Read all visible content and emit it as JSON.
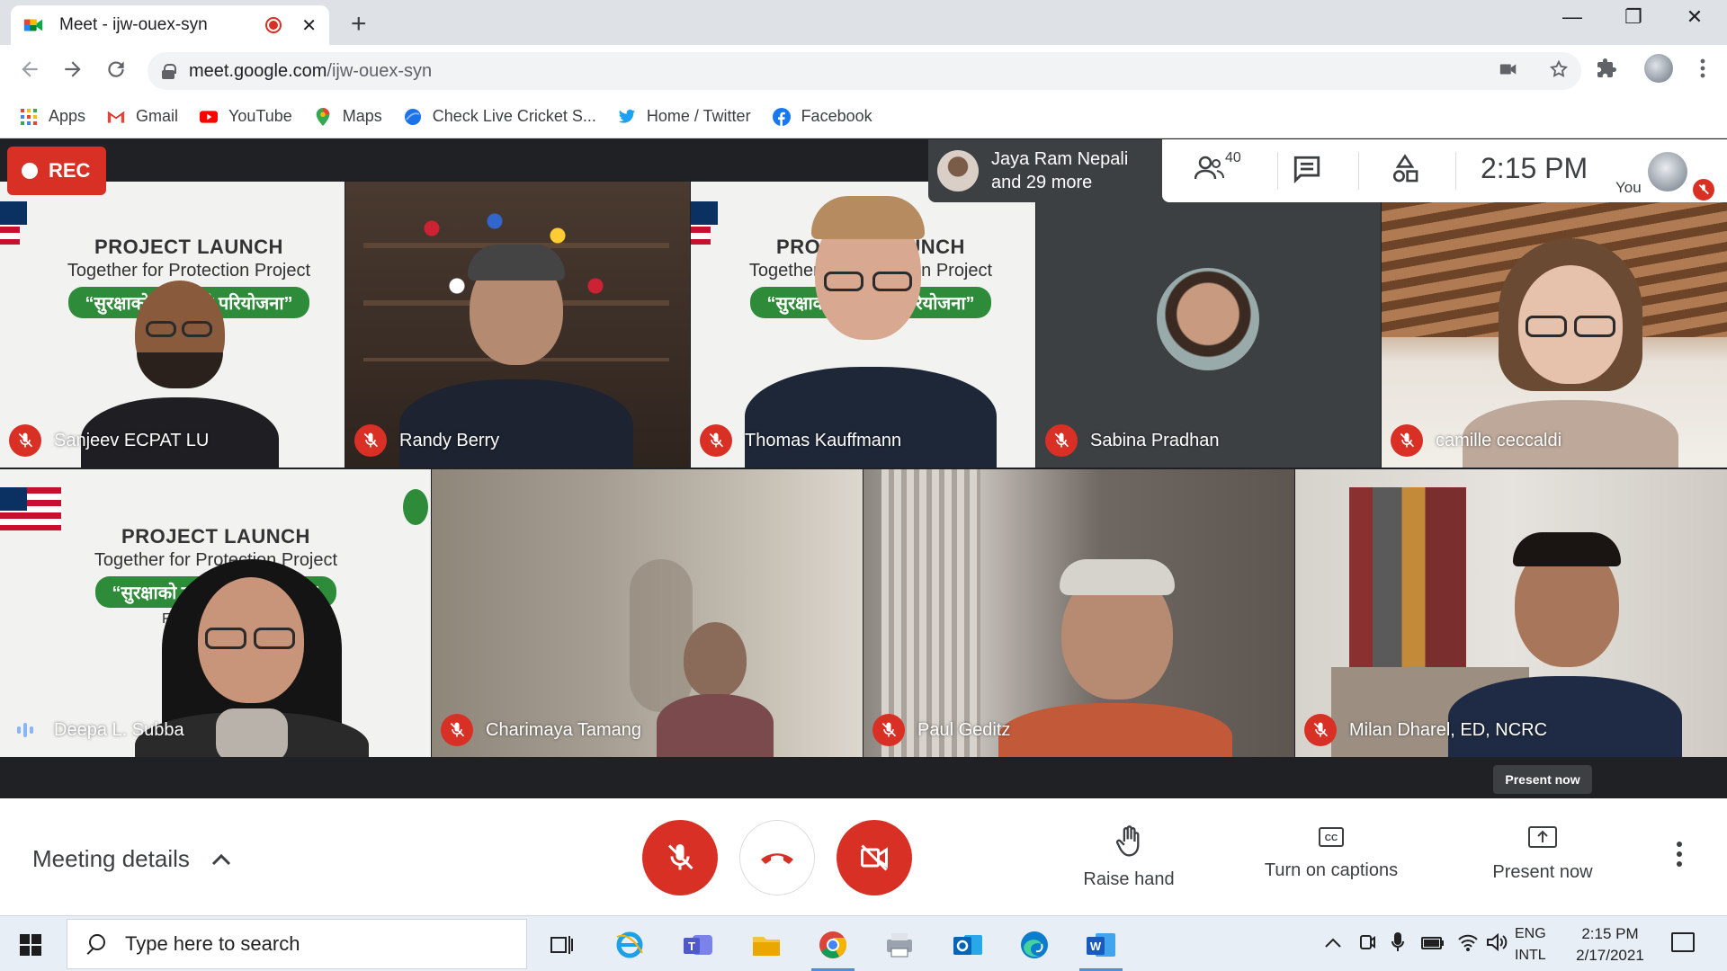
{
  "browser": {
    "tab_title": "Meet - ijw-ouex-syn",
    "tab_close": "✕",
    "new_tab": "+",
    "window_controls": [
      "—",
      "❐",
      "✕"
    ],
    "url_host": "meet.google.com",
    "url_path": "/ijw-ouex-syn",
    "bookmarks": [
      {
        "label": "Apps",
        "icon": "apps-grid-icon"
      },
      {
        "label": "Gmail",
        "icon": "gmail-icon"
      },
      {
        "label": "YouTube",
        "icon": "youtube-icon"
      },
      {
        "label": "Maps",
        "icon": "maps-pin-icon"
      },
      {
        "label": "Check Live Cricket S...",
        "icon": "cricket-site-icon"
      },
      {
        "label": "Home / Twitter",
        "icon": "twitter-icon"
      },
      {
        "label": "Facebook",
        "icon": "facebook-icon"
      }
    ]
  },
  "meet": {
    "rec_label": "REC",
    "notification_line1": "Jaya Ram Nepali",
    "notification_line2": "and 29 more",
    "participant_count": "40",
    "time": "2:15 PM",
    "you_label": "You",
    "present_tooltip": "Present now",
    "banner": {
      "line1": "PROJECT LAUNCH",
      "line2": "Together for Protection Project",
      "line3": "“सुरक्षाको लागि सँगै परियोजना”",
      "feb": "Feb"
    },
    "participants": [
      {
        "name": "Sanjeev ECPAT LU",
        "muted": true
      },
      {
        "name": "Randy Berry",
        "muted": true
      },
      {
        "name": "Thomas Kauffmann",
        "muted": true
      },
      {
        "name": "Sabina Pradhan",
        "muted": true
      },
      {
        "name": "camille ceccaldi",
        "muted": true
      },
      {
        "name": "Deepa L. Subba",
        "muted": false
      },
      {
        "name": "Charimaya Tamang",
        "muted": true
      },
      {
        "name": "Paul Geditz",
        "muted": true
      },
      {
        "name": "Milan Dharel, ED, NCRC",
        "muted": true
      }
    ]
  },
  "controls": {
    "meeting_details": "Meeting details",
    "raise_hand": "Raise hand",
    "captions": "Turn on captions",
    "present_now": "Present now"
  },
  "taskbar": {
    "search_placeholder": "Type here to search",
    "lang_line1": "ENG",
    "lang_line2": "INTL",
    "clock_time": "2:15 PM",
    "clock_date": "2/17/2021"
  },
  "colors": {
    "meet_red": "#d93025",
    "stage_bg": "#202124",
    "speaking_blue": "#8ab4f8"
  }
}
